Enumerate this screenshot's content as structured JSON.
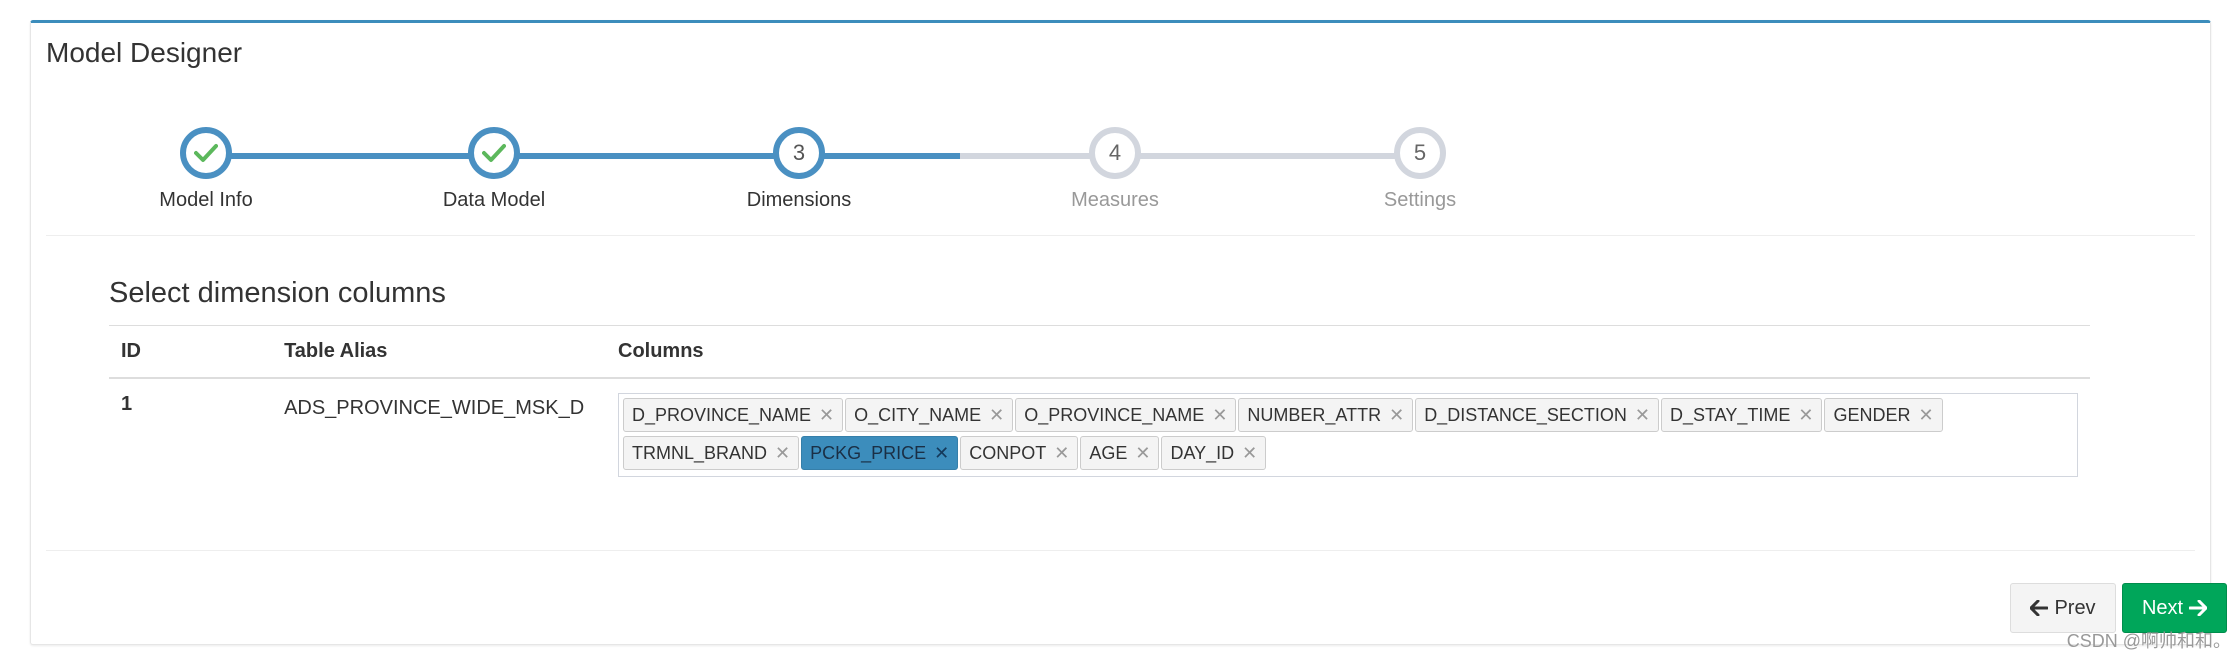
{
  "panel": {
    "title": "Model Designer"
  },
  "wizard": {
    "steps": [
      {
        "label": "Model Info",
        "number": "1",
        "state": "done",
        "icon": "check-icon"
      },
      {
        "label": "Data Model",
        "number": "2",
        "state": "done",
        "icon": "check-icon"
      },
      {
        "label": "Dimensions",
        "number": "3",
        "state": "active"
      },
      {
        "label": "Measures",
        "number": "4",
        "state": "todo"
      },
      {
        "label": "Settings",
        "number": "5",
        "state": "todo"
      }
    ]
  },
  "section": {
    "title": "Select dimension columns"
  },
  "table": {
    "headers": {
      "id": "ID",
      "alias": "Table Alias",
      "columns": "Columns"
    },
    "rows": [
      {
        "id": "1",
        "alias": "ADS_PROVINCE_WIDE_MSK_D",
        "columns": [
          {
            "name": "D_PROVINCE_NAME",
            "selected": false
          },
          {
            "name": "O_CITY_NAME",
            "selected": false
          },
          {
            "name": "O_PROVINCE_NAME",
            "selected": false
          },
          {
            "name": "NUMBER_ATTR",
            "selected": false
          },
          {
            "name": "D_DISTANCE_SECTION",
            "selected": false
          },
          {
            "name": "D_STAY_TIME",
            "selected": false
          },
          {
            "name": "GENDER",
            "selected": false
          },
          {
            "name": "TRMNL_BRAND",
            "selected": false
          },
          {
            "name": "PCKG_PRICE",
            "selected": true
          },
          {
            "name": "CONPOT",
            "selected": false
          },
          {
            "name": "AGE",
            "selected": false
          },
          {
            "name": "DAY_ID",
            "selected": false
          }
        ]
      }
    ]
  },
  "buttons": {
    "prev": "Prev",
    "next": "Next"
  },
  "watermark": "CSDN @啊帅和和。",
  "colors": {
    "primary": "#3c8dbc",
    "progress": "#4a90c2",
    "track": "#d2d6de",
    "check": "#5cb85c",
    "success": "#00a65a"
  }
}
